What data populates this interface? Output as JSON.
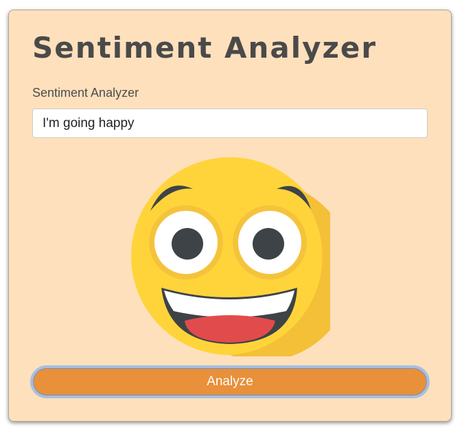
{
  "app": {
    "title": "Sentiment Analyzer"
  },
  "form": {
    "label": "Sentiment Analyzer",
    "input_value": "I'm going happy",
    "button_label": "Analyze"
  },
  "result": {
    "emoji_icon": "laughing-face-icon"
  },
  "colors": {
    "card_background": "#fee0bc",
    "title_text": "#4a4a4a",
    "button_background": "#e8903a",
    "button_focus_ring": "#a8bfe0",
    "emoji_face": "#ffd43b",
    "emoji_shade": "#f5c33b",
    "emoji_features": "#3e4347",
    "emoji_tongue": "#e24b4b"
  }
}
